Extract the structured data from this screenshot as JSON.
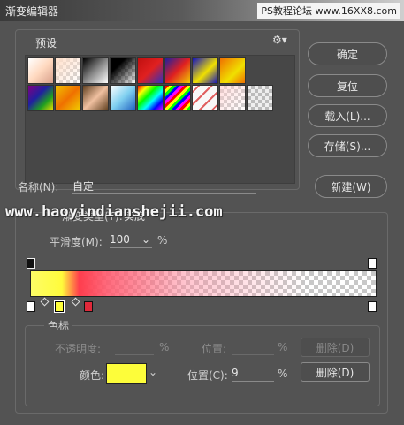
{
  "window": {
    "title": "渐变编辑器"
  },
  "watermark": {
    "top": "PS教程论坛 www.16XX8.com",
    "middle": "www.haoyindianshejii.com"
  },
  "presets": {
    "label": "预设",
    "gear_icon": "gear-icon"
  },
  "buttons": {
    "ok": "确定",
    "reset": "复位",
    "load": "载入(L)...",
    "save": "存储(S)...",
    "new": "新建(W)"
  },
  "name": {
    "label": "名称(N):",
    "value": "自定"
  },
  "gradient": {
    "type_label": "渐变类型(T):",
    "type_value": "实底",
    "smoothness_label": "平滑度(M):",
    "smoothness_value": "100",
    "smoothness_unit": "%",
    "stops_label": "色标",
    "opacity_label": "不透明度:",
    "opacity_unit": "%",
    "opacity_location_label": "位置:",
    "opacity_location_unit": "%",
    "opacity_delete": "删除(D)",
    "color_label": "颜色:",
    "color_value": "#fdfd3a",
    "color_location_label": "位置(C):",
    "color_location_value": "9",
    "color_location_unit": "%",
    "color_delete": "删除(D)"
  },
  "colors": {
    "accent_yellow": "#fdfd3a",
    "accent_red": "#e0293a",
    "panel": "#535353"
  }
}
